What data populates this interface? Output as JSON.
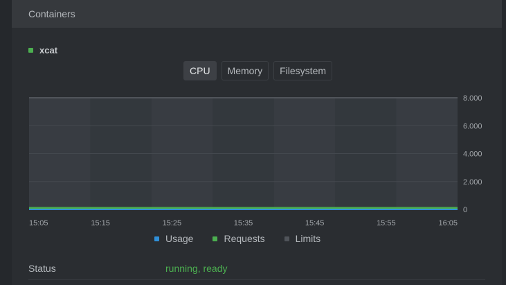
{
  "panel": {
    "title": "Containers"
  },
  "container": {
    "name": "xcat",
    "status_color": "#4caf50"
  },
  "tabs": [
    {
      "label": "CPU",
      "active": true
    },
    {
      "label": "Memory",
      "active": false
    },
    {
      "label": "Filesystem",
      "active": false
    }
  ],
  "legend": [
    {
      "label": "Usage",
      "color": "#2f8fd8"
    },
    {
      "label": "Requests",
      "color": "#4caf50"
    },
    {
      "label": "Limits",
      "color": "#50545a"
    }
  ],
  "status": {
    "label": "Status",
    "value": "running, ready"
  },
  "chart_data": {
    "type": "area",
    "x": [
      "15:05",
      "15:15",
      "15:25",
      "15:35",
      "15:45",
      "15:55",
      "16:05"
    ],
    "y_ticks": [
      "0",
      "2.000",
      "4.000",
      "6.000",
      "8.000"
    ],
    "ylim": [
      0,
      8
    ],
    "grid": true,
    "legend_position": "bottom",
    "series": [
      {
        "name": "Limits",
        "values": [
          8,
          8,
          8,
          8,
          8,
          8,
          8
        ],
        "color": "#50545a"
      },
      {
        "name": "Requests",
        "values": [
          0.1,
          0.1,
          0.1,
          0.1,
          0.1,
          0.1,
          0.1
        ],
        "color": "#4caf50"
      },
      {
        "name": "Usage",
        "values": [
          0,
          0,
          0,
          0,
          0,
          0,
          0
        ],
        "color": "#2f8fd8"
      }
    ]
  }
}
